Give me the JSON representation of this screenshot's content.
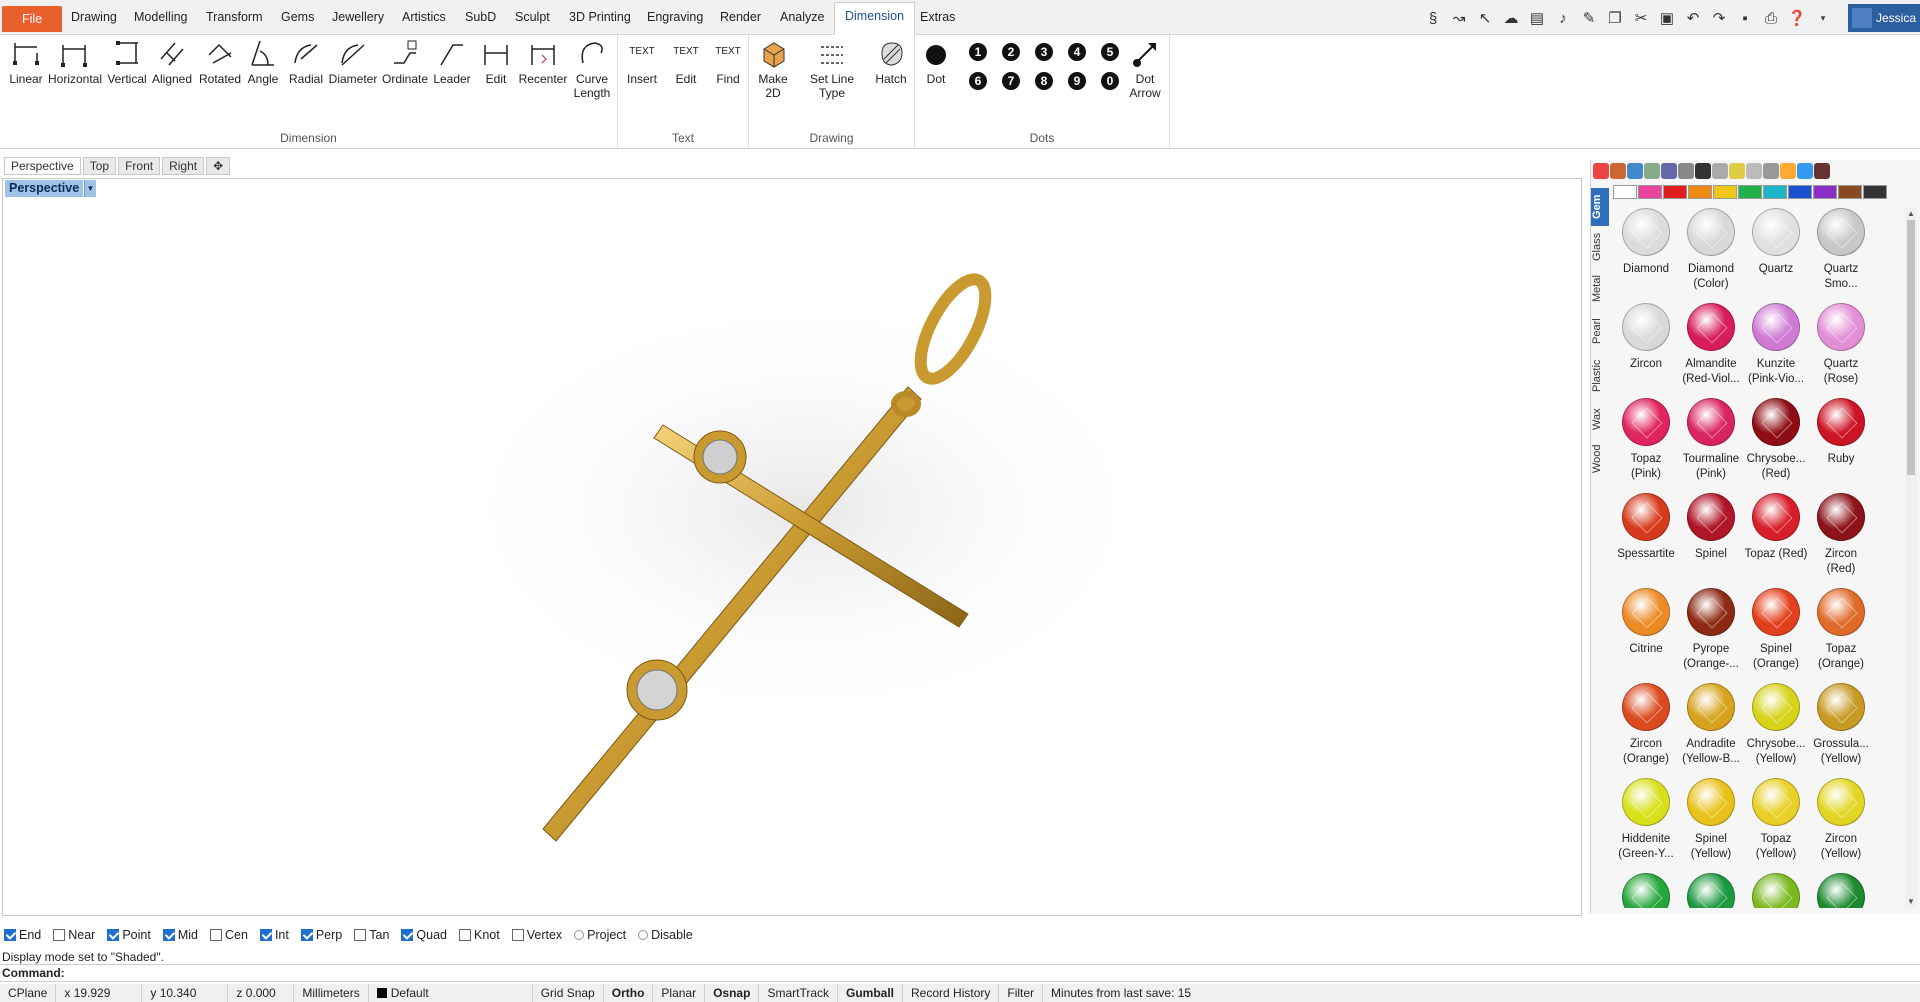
{
  "menu": {
    "file": "File",
    "tabs": [
      "Drawing",
      "Modelling",
      "Transform",
      "Gems",
      "Jewellery",
      "Artistics",
      "SubD",
      "Sculpt",
      "3D Printing",
      "Engraving",
      "Render",
      "Analyze",
      "Dimension",
      "Extras"
    ],
    "active": "Dimension",
    "user": "Jessica"
  },
  "ribbon": {
    "dimension_group": "Dimension",
    "text_group": "Text",
    "drawing_group": "Drawing",
    "dots_group": "Dots",
    "buttons": {
      "linear": "Linear",
      "horizontal": "Horizontal",
      "vertical": "Vertical",
      "aligned": "Aligned",
      "rotated": "Rotated",
      "angle": "Angle",
      "radial": "Radial",
      "diameter": "Diameter",
      "ordinate": "Ordinate",
      "leader": "Leader",
      "edit_dim": "Edit",
      "recenter": "Recenter",
      "curve_length_1": "Curve",
      "curve_length_2": "Length",
      "insert": "Insert",
      "edit_text": "Edit",
      "find": "Find",
      "make2d_1": "Make",
      "make2d_2": "2D",
      "set_line_type": "Set Line Type",
      "hatch": "Hatch",
      "dot": "Dot",
      "dot_arrow_1": "Dot",
      "dot_arrow_2": "Arrow"
    },
    "icon_text": {
      "insert": "TEXT",
      "edit": "TEXT",
      "find": "TEXT"
    },
    "numbered_dots": [
      "1",
      "2",
      "3",
      "4",
      "5",
      "6",
      "7",
      "8",
      "9",
      "0"
    ]
  },
  "viewport": {
    "tabs": [
      "Perspective",
      "Top",
      "Front",
      "Right"
    ],
    "active_label": "Perspective"
  },
  "panel": {
    "side_tabs": [
      "Gem",
      "Glass",
      "Metal",
      "Pearl",
      "Plastic",
      "Wax",
      "Wood"
    ],
    "swatch_colors": [
      "#ffffff",
      "#e8439a",
      "#e02020",
      "#f08a14",
      "#f3c514",
      "#1fb24a",
      "#19b7c8",
      "#1a4fd0",
      "#8c2fc8",
      "#8a4a23",
      "#333333"
    ],
    "gems": [
      {
        "l1": "Diamond",
        "l2": "",
        "c": "#dcdcdc"
      },
      {
        "l1": "Diamond",
        "l2": "(Color)",
        "c": "#d8d8d8"
      },
      {
        "l1": "Quartz",
        "l2": "",
        "c": "#e0e0e0"
      },
      {
        "l1": "Quartz",
        "l2": "Smo...",
        "c": "#c8c8c8"
      },
      {
        "l1": "Zircon",
        "l2": "",
        "c": "#d9d9d9"
      },
      {
        "l1": "Almandite",
        "l2": "(Red-Viol...",
        "c": "#d81d5a"
      },
      {
        "l1": "Kunzite",
        "l2": "(Pink-Vio...",
        "c": "#cf7bd6"
      },
      {
        "l1": "Quartz",
        "l2": "(Rose)",
        "c": "#e38fd6"
      },
      {
        "l1": "Topaz",
        "l2": "(Pink)",
        "c": "#e0245e"
      },
      {
        "l1": "Tourmaline",
        "l2": "(Pink)",
        "c": "#d82460"
      },
      {
        "l1": "Chrysobe...",
        "l2": "(Red)",
        "c": "#8e0c14"
      },
      {
        "l1": "Ruby",
        "l2": "",
        "c": "#cc1424"
      },
      {
        "l1": "Spessartite",
        "l2": "",
        "c": "#d63a1c"
      },
      {
        "l1": "Spinel",
        "l2": "",
        "c": "#b01528"
      },
      {
        "l1": "Topaz (Red)",
        "l2": "",
        "c": "#d81e2a"
      },
      {
        "l1": "Zircon",
        "l2": "(Red)",
        "c": "#8d1219"
      },
      {
        "l1": "Citrine",
        "l2": "",
        "c": "#ec8a26"
      },
      {
        "l1": "Pyrope",
        "l2": "(Orange-...",
        "c": "#8e2a14"
      },
      {
        "l1": "Spinel",
        "l2": "(Orange)",
        "c": "#e2401c"
      },
      {
        "l1": "Topaz",
        "l2": "(Orange)",
        "c": "#e06a2a"
      },
      {
        "l1": "Zircon",
        "l2": "(Orange)",
        "c": "#db4a1e"
      },
      {
        "l1": "Andradite",
        "l2": "(Yellow-B...",
        "c": "#d7a21c"
      },
      {
        "l1": "Chrysobe...",
        "l2": "(Yellow)",
        "c": "#d7d21a"
      },
      {
        "l1": "Grossula...",
        "l2": "(Yellow)",
        "c": "#c79a24"
      },
      {
        "l1": "Hiddenite",
        "l2": "(Green-Y...",
        "c": "#d8e01a"
      },
      {
        "l1": "Spinel",
        "l2": "(Yellow)",
        "c": "#e8c21a"
      },
      {
        "l1": "Topaz",
        "l2": "(Yellow)",
        "c": "#e8d026"
      },
      {
        "l1": "Zircon",
        "l2": "(Yellow)",
        "c": "#e2d624"
      },
      {
        "l1": "",
        "l2": "",
        "c": "#25a63a"
      },
      {
        "l1": "",
        "l2": "",
        "c": "#1c9a40"
      },
      {
        "l1": "",
        "l2": "",
        "c": "#7ab81e"
      },
      {
        "l1": "",
        "l2": "",
        "c": "#1e8a30"
      }
    ]
  },
  "osnap": [
    {
      "label": "End",
      "on": true
    },
    {
      "label": "Near",
      "on": false
    },
    {
      "label": "Point",
      "on": true
    },
    {
      "label": "Mid",
      "on": true
    },
    {
      "label": "Cen",
      "on": false
    },
    {
      "label": "Int",
      "on": true
    },
    {
      "label": "Perp",
      "on": true
    },
    {
      "label": "Tan",
      "on": false
    },
    {
      "label": "Quad",
      "on": true
    },
    {
      "label": "Knot",
      "on": false
    },
    {
      "label": "Vertex",
      "on": false
    }
  ],
  "osnap_radio": [
    "Project",
    "Disable"
  ],
  "command": {
    "history": "Display mode set to \"Shaded\".",
    "prompt": "Command:"
  },
  "status": {
    "cplane": "CPlane",
    "x": "x 19.929",
    "y": "y 10.340",
    "z": "z 0.000",
    "units": "Millimeters",
    "layer": "Default",
    "grid_snap": "Grid Snap",
    "ortho": "Ortho",
    "planar": "Planar",
    "osnap": "Osnap",
    "smarttrack": "SmartTrack",
    "gumball": "Gumball",
    "record_history": "Record History",
    "filter": "Filter",
    "save": "Minutes from last save: 15"
  },
  "colors": {
    "accent": "#2d6fbd",
    "file": "#e9602d",
    "gold": "#d9a93c"
  }
}
